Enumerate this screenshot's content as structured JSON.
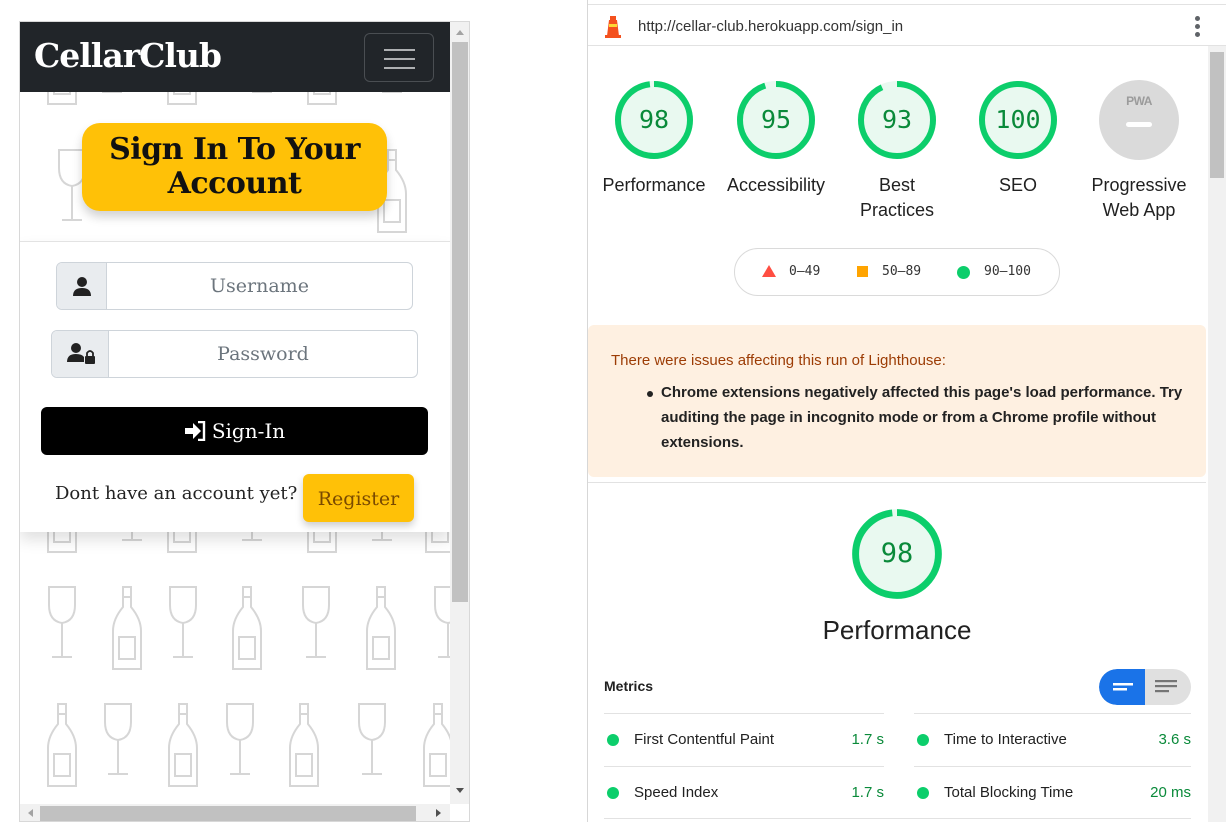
{
  "app": {
    "brand": "CellarClub",
    "page_heading_line1": "Sign In To Your",
    "page_heading_line2": "Account",
    "username_placeholder": "Username",
    "password_placeholder": "Password",
    "signin_label": "Sign-In",
    "register_prompt": "Dont have an account yet?",
    "register_label": "Register",
    "colors": {
      "navbar": "#212529",
      "accent": "#ffc107",
      "button": "#000000"
    }
  },
  "lighthouse": {
    "url": "http://cellar-club.herokuapp.com/sign_in",
    "scores": [
      {
        "label_line1": "Performance",
        "label_line2": "",
        "score": "98",
        "score_value": 98
      },
      {
        "label_line1": "Accessibility",
        "label_line2": "",
        "score": "95",
        "score_value": 95
      },
      {
        "label_line1": "Best",
        "label_line2": "Practices",
        "score": "93",
        "score_value": 93
      },
      {
        "label_line1": "SEO",
        "label_line2": "",
        "score": "100",
        "score_value": 100
      },
      {
        "label_line1": "Progressive",
        "label_line2": "Web App",
        "badge": "PWA"
      }
    ],
    "legend": [
      {
        "range": "0–49",
        "color": "#ff4e42",
        "shape": "triangle"
      },
      {
        "range": "50–89",
        "color": "#ffa400",
        "shape": "square"
      },
      {
        "range": "90–100",
        "color": "#0cce6b",
        "shape": "circle"
      }
    ],
    "warning": {
      "title": "There were issues affecting this run of Lighthouse:",
      "item": "Chrome extensions negatively affected this page's load performance. Try auditing the page in incognito mode or from a Chrome profile without extensions."
    },
    "performance": {
      "score": "98",
      "score_value": 98,
      "title": "Performance"
    },
    "metrics_label": "Metrics",
    "metrics": [
      {
        "name": "First Contentful Paint",
        "value": "1.7 s"
      },
      {
        "name": "Time to Interactive",
        "value": "3.6 s"
      },
      {
        "name": "Speed Index",
        "value": "1.7 s"
      },
      {
        "name": "Total Blocking Time",
        "value": "20 ms"
      }
    ],
    "colors": {
      "pass": "#0cce6b",
      "pass_text": "#0a8a3a",
      "warning_bg": "#fef0e1"
    }
  }
}
